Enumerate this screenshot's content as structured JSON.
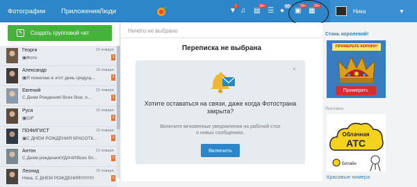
{
  "topbar": {
    "nav": [
      "Фотографии",
      "Приложения",
      "Люди"
    ],
    "badges": [
      {
        "icon": "likes-icon",
        "count": "1"
      },
      {
        "icon": "music-icon",
        "count": ""
      },
      {
        "icon": "news-icon",
        "count": "99+"
      },
      {
        "icon": "list-icon",
        "count": ""
      },
      {
        "icon": "games-icon",
        "count": "67"
      },
      {
        "icon": "gifts-icon",
        "count": "99+"
      },
      {
        "icon": "messages-icon",
        "count": "99+"
      }
    ],
    "user_name": "Ника",
    "caret": "▼"
  },
  "left": {
    "create_group_label": "Создать групповой чат",
    "contacts": [
      {
        "name": "Георги",
        "date": "15 января",
        "message": "Фото",
        "count": "1"
      },
      {
        "name": "Александр",
        "date": "15 января",
        "message": "Я пожелаю в этот день грядущ...",
        "count": "1"
      },
      {
        "name": "Евгений",
        "date": "15 января",
        "message": "С Днем Рождения! Всех благ, п...",
        "count": "1"
      },
      {
        "name": "Руся",
        "date": "15 января",
        "message": "GIF",
        "count": "2"
      },
      {
        "name": "ПОФИГИСТ",
        "date": "15 января",
        "message": "С ДНЕМ РОЖДЕНИЯ КРАСОТК...",
        "count": "1"
      },
      {
        "name": "Антон",
        "date": "15 января",
        "message": "С Днем рождения!УДАЧИ!Всех бл...",
        "count": "1"
      },
      {
        "name": "Леонид",
        "date": "15 января",
        "message": "Ника, С ДНЕМ РОЖДЕНИЯ!!!!!!!!!!!",
        "count": "1"
      }
    ]
  },
  "center": {
    "selected_label": "Ничего не выбрано",
    "title": "Переписка не выбрана",
    "notice": {
      "close": "×",
      "headline": "Хотите оставаться на связи, даже когда Фотострана закрыта?",
      "body": "Включите мгновенные уведомления на рабочий стол о новых сообщениях.",
      "button": "Включить"
    }
  },
  "right": {
    "promo_heading": "Стань королевой!",
    "promo_banner": "ПРИМЕРЬТЕ КОРОНУ!",
    "promo_button": "Примерить",
    "ads_label": "Реклама",
    "ad_top": "Облачная",
    "ad_main": "АТС",
    "ad_brand": "Билайн",
    "ad_caption": "Красивые номера"
  },
  "colors": {
    "accent": "#2d86c8",
    "green": "#44b33a",
    "orange": "#e07838",
    "red": "#d92d2d"
  }
}
